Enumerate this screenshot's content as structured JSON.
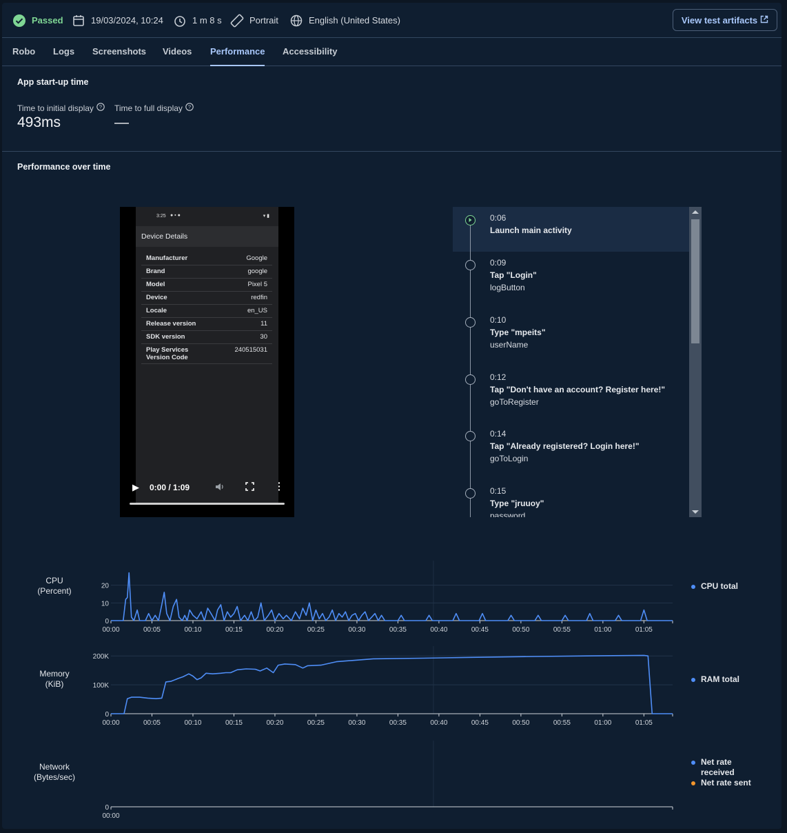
{
  "header": {
    "status": "Passed",
    "datetime": "19/03/2024, 10:24",
    "duration": "1 m 8 s",
    "orientation": "Portrait",
    "locale": "English (United States)",
    "artifacts_button": "View test artifacts"
  },
  "tabs": [
    "Robo",
    "Logs",
    "Screenshots",
    "Videos",
    "Performance",
    "Accessibility"
  ],
  "active_tab": "Performance",
  "startup": {
    "title": "App start-up time",
    "initial_label": "Time to initial display",
    "initial_value": "493ms",
    "full_label": "Time to full display",
    "full_value": "—"
  },
  "perf_title": "Performance over time",
  "video": {
    "status_time": "3:25",
    "screen_title": "Device Details",
    "rows": [
      {
        "k": "Manufacturer",
        "v": "Google"
      },
      {
        "k": "Brand",
        "v": "google"
      },
      {
        "k": "Model",
        "v": "Pixel 5"
      },
      {
        "k": "Device",
        "v": "redfin"
      },
      {
        "k": "Locale",
        "v": "en_US"
      },
      {
        "k": "Release version",
        "v": "11"
      },
      {
        "k": "SDK version",
        "v": "30"
      },
      {
        "k": "Play Services Version Code",
        "v": "240515031"
      }
    ],
    "time": "0:00 / 1:09"
  },
  "timeline": [
    {
      "time": "0:06",
      "action": "Launch main activity",
      "resource": ""
    },
    {
      "time": "0:09",
      "action": "Tap \"Login\"",
      "resource": "logButton"
    },
    {
      "time": "0:10",
      "action": "Type \"mpeits\"",
      "resource": "userName"
    },
    {
      "time": "0:12",
      "action": "Tap \"Don't have an account? Register here!\"",
      "resource": "goToRegister"
    },
    {
      "time": "0:14",
      "action": "Tap \"Already registered? Login here!\"",
      "resource": "goToLogin"
    },
    {
      "time": "0:15",
      "action": "Type \"jruuoy\"",
      "resource": "password"
    }
  ],
  "charts": {
    "cpu_label_1": "CPU",
    "cpu_label_2": "(Percent)",
    "cpu_legend": "CPU total",
    "mem_label_1": "Memory",
    "mem_label_2": "(KiB)",
    "mem_legend": "RAM total",
    "net_label_1": "Network",
    "net_label_2": "(Bytes/sec)",
    "net_legend_received": "Net rate received",
    "net_legend_sent": "Net rate sent",
    "colors": {
      "blue": "#4f8ef7",
      "orange": "#f2952c"
    }
  },
  "chart_data": [
    {
      "type": "line",
      "series": [
        {
          "name": "CPU total",
          "points": [
            [
              0,
              0
            ],
            [
              1.5,
              0
            ],
            [
              1.8,
              12
            ],
            [
              2.0,
              13
            ],
            [
              2.2,
              27
            ],
            [
              2.5,
              2
            ],
            [
              2.8,
              0
            ],
            [
              3.2,
              6
            ],
            [
              3.5,
              0
            ],
            [
              4.2,
              0
            ],
            [
              4.6,
              4
            ],
            [
              5.0,
              0
            ],
            [
              5.4,
              3
            ],
            [
              5.8,
              0
            ],
            [
              6.2,
              9
            ],
            [
              6.5,
              16
            ],
            [
              6.8,
              4
            ],
            [
              7.2,
              0
            ],
            [
              7.6,
              8
            ],
            [
              8.0,
              12
            ],
            [
              8.3,
              2
            ],
            [
              8.7,
              0
            ],
            [
              9.0,
              3
            ],
            [
              9.3,
              0
            ],
            [
              9.6,
              6
            ],
            [
              10.0,
              3
            ],
            [
              10.5,
              1
            ],
            [
              11.0,
              5
            ],
            [
              11.4,
              0
            ],
            [
              11.8,
              7
            ],
            [
              12.2,
              4
            ],
            [
              12.7,
              0
            ],
            [
              13.0,
              6
            ],
            [
              13.4,
              9
            ],
            [
              13.8,
              0
            ],
            [
              14.2,
              5
            ],
            [
              14.6,
              2
            ],
            [
              15.0,
              4
            ],
            [
              15.4,
              8
            ],
            [
              15.8,
              0
            ],
            [
              16.3,
              3
            ],
            [
              16.7,
              0
            ],
            [
              17.1,
              5
            ],
            [
              17.5,
              0
            ],
            [
              17.9,
              2
            ],
            [
              18.3,
              10
            ],
            [
              18.7,
              0
            ],
            [
              19.2,
              3
            ],
            [
              19.6,
              6
            ],
            [
              20.0,
              0
            ],
            [
              20.5,
              4
            ],
            [
              21.0,
              1
            ],
            [
              21.4,
              3
            ],
            [
              22.0,
              0
            ],
            [
              22.5,
              5
            ],
            [
              23.0,
              1
            ],
            [
              23.4,
              7
            ],
            [
              23.8,
              3
            ],
            [
              24.2,
              10
            ],
            [
              24.6,
              0
            ],
            [
              25.0,
              6
            ],
            [
              25.4,
              1
            ],
            [
              25.8,
              4
            ],
            [
              26.2,
              0
            ],
            [
              26.6,
              2
            ],
            [
              27.0,
              6
            ],
            [
              27.4,
              0
            ],
            [
              27.8,
              4
            ],
            [
              28.2,
              2
            ],
            [
              28.6,
              5
            ],
            [
              29.0,
              0
            ],
            [
              29.4,
              3
            ],
            [
              29.8,
              4
            ],
            [
              30.2,
              0
            ],
            [
              30.6,
              3
            ],
            [
              31.0,
              5
            ],
            [
              31.4,
              0
            ],
            [
              31.8,
              2
            ],
            [
              32.2,
              4
            ],
            [
              32.6,
              0
            ],
            [
              33.0,
              3
            ],
            [
              33.4,
              0
            ],
            [
              35.0,
              0
            ],
            [
              35.4,
              3
            ],
            [
              35.8,
              0
            ],
            [
              38.4,
              0
            ],
            [
              38.8,
              3
            ],
            [
              39.2,
              0
            ],
            [
              41.7,
              0
            ],
            [
              42.1,
              4
            ],
            [
              42.5,
              0
            ],
            [
              44.9,
              0
            ],
            [
              45.3,
              4
            ],
            [
              45.7,
              0
            ],
            [
              48.4,
              0
            ],
            [
              48.8,
              3
            ],
            [
              49.2,
              0
            ],
            [
              51.7,
              0
            ],
            [
              52.1,
              3
            ],
            [
              52.5,
              0
            ],
            [
              55.0,
              0
            ],
            [
              55.4,
              3
            ],
            [
              55.8,
              0
            ],
            [
              58.0,
              0
            ],
            [
              58.4,
              4
            ],
            [
              58.8,
              0
            ],
            [
              61.5,
              0
            ],
            [
              61.9,
              3
            ],
            [
              62.3,
              0
            ],
            [
              64.6,
              0
            ],
            [
              65.0,
              6
            ],
            [
              65.4,
              0
            ],
            [
              68.5,
              0
            ]
          ]
        }
      ],
      "x_ticks": [
        "00:00",
        "00:05",
        "00:10",
        "00:15",
        "00:20",
        "00:25",
        "00:30",
        "00:35",
        "00:40",
        "00:45",
        "00:50",
        "00:55",
        "01:00",
        "01:05"
      ],
      "y_ticks": [
        "0",
        "10",
        "20"
      ],
      "ylim": [
        0,
        30
      ]
    },
    {
      "type": "line",
      "series": [
        {
          "name": "RAM total",
          "points": [
            [
              0,
              0
            ],
            [
              1.6,
              0
            ],
            [
              2.0,
              52000
            ],
            [
              2.5,
              57000
            ],
            [
              3.5,
              57000
            ],
            [
              4.5,
              54000
            ],
            [
              5.5,
              52000
            ],
            [
              6.2,
              54000
            ],
            [
              6.7,
              110000
            ],
            [
              7.3,
              112000
            ],
            [
              8.2,
              122000
            ],
            [
              8.8,
              128000
            ],
            [
              9.5,
              138000
            ],
            [
              10.0,
              130000
            ],
            [
              10.5,
              118000
            ],
            [
              11.0,
              124000
            ],
            [
              11.6,
              140000
            ],
            [
              12.4,
              138000
            ],
            [
              13.4,
              140000
            ],
            [
              14.0,
              142000
            ],
            [
              14.6,
              142000
            ],
            [
              15.4,
              152000
            ],
            [
              16.5,
              155000
            ],
            [
              17.6,
              154000
            ],
            [
              18.2,
              148000
            ],
            [
              19.0,
              158000
            ],
            [
              19.8,
              142000
            ],
            [
              20.4,
              168000
            ],
            [
              21.2,
              172000
            ],
            [
              22.5,
              170000
            ],
            [
              23.4,
              158000
            ],
            [
              24.0,
              166000
            ],
            [
              25.6,
              168000
            ],
            [
              27.5,
              180000
            ],
            [
              32.0,
              190000
            ],
            [
              38.0,
              192000
            ],
            [
              44.0,
              195000
            ],
            [
              52.0,
              198000
            ],
            [
              58.0,
              200000
            ],
            [
              65.0,
              202000
            ],
            [
              65.5,
              200000
            ],
            [
              66.0,
              0
            ],
            [
              68.5,
              0
            ]
          ]
        }
      ],
      "x_ticks": [
        "00:00",
        "00:05",
        "00:10",
        "00:15",
        "00:20",
        "00:25",
        "00:30",
        "00:35",
        "00:40",
        "00:45",
        "00:50",
        "00:55",
        "01:00",
        "01:05"
      ],
      "y_ticks": [
        "0",
        "100K",
        "200K"
      ],
      "ylim": [
        0,
        210000
      ]
    },
    {
      "type": "line",
      "series": [
        {
          "name": "Net rate received",
          "points": []
        },
        {
          "name": "Net rate sent",
          "points": []
        }
      ],
      "x_ticks": [
        "00:00"
      ],
      "y_ticks": [
        "0"
      ]
    }
  ]
}
